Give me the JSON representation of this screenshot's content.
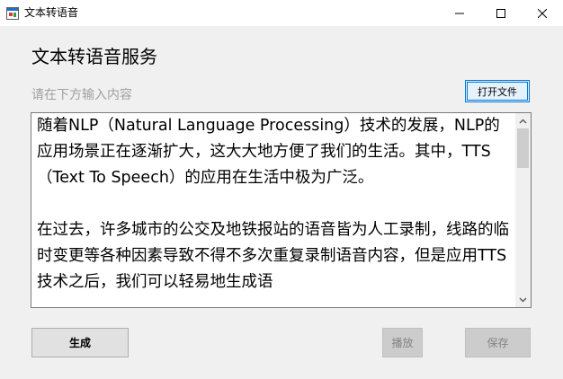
{
  "window": {
    "title": "文本转语音",
    "controls": {
      "minimize_icon": "minimize-icon",
      "maximize_icon": "maximize-icon",
      "close_icon": "close-icon"
    }
  },
  "main": {
    "heading": "文本转语音服务",
    "input_hint": "请在下方输入内容",
    "open_file_label": "打开文件",
    "text_content": "随着NLP（Natural Language Processing）技术的发展，NLP的应用场景正在逐渐扩大，这大大地方便了我们的生活。其中，TTS（Text To Speech）的应用在生活中极为广泛。\n\n在过去，许多城市的公交及地铁报站的语音皆为人工录制，线路的临时变更等各种因素导致不得不多次重复录制语音内容，但是应用TTS技术之后，我们可以轻易地生成语"
  },
  "buttons": {
    "generate": "生成",
    "play": "播放",
    "save": "保存"
  },
  "colors": {
    "accent": "#0078d7",
    "window_bg": "#f0f0f0",
    "disabled_text": "#838383"
  }
}
